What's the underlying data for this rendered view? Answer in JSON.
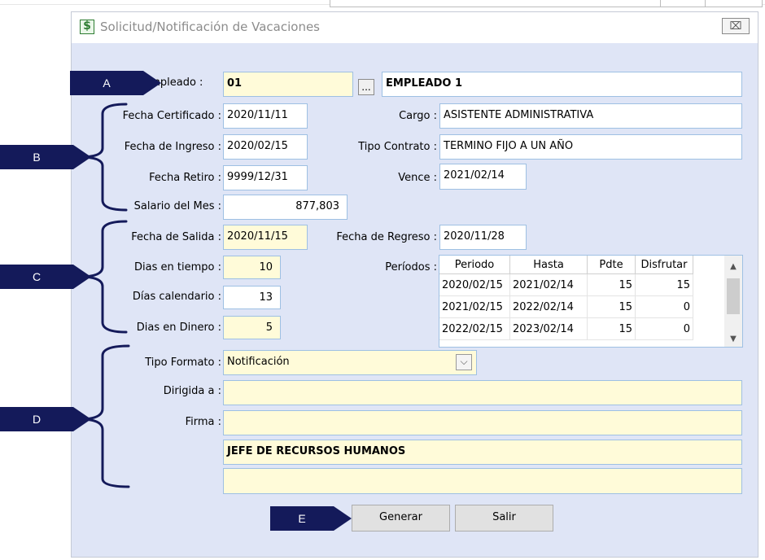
{
  "window": {
    "title": "Solicitud/Notificación de Vacaciones",
    "close_glyph": "⌧",
    "icon_glyph": "$"
  },
  "callouts": {
    "a": "A",
    "b": "B",
    "c": "C",
    "d": "D",
    "e": "E"
  },
  "employee": {
    "label": "Empleado :",
    "code": "01",
    "lookup": "...",
    "name": "EMPLEADO 1"
  },
  "fecha_certificado": {
    "label": "Fecha Certificado :",
    "value": "2020/11/11"
  },
  "fecha_ingreso": {
    "label": "Fecha de Ingreso :",
    "value": "2020/02/15"
  },
  "fecha_retiro": {
    "label": "Fecha Retiro :",
    "value": "9999/12/31"
  },
  "salario": {
    "label": "Salario del Mes :",
    "value": "877,803"
  },
  "cargo": {
    "label": "Cargo :",
    "value": "ASISTENTE ADMINISTRATIVA"
  },
  "tipo_contrato": {
    "label": "Tipo Contrato :",
    "value": "TERMINO FIJO A UN AÑO"
  },
  "vence": {
    "label": "Vence :",
    "value": "2021/02/14"
  },
  "fecha_salida": {
    "label": "Fecha de Salida :",
    "value": "2020/11/15"
  },
  "fecha_regreso": {
    "label": "Fecha de Regreso :",
    "value": "2020/11/28"
  },
  "dias_tiempo": {
    "label": "Dias en tiempo :",
    "value": "10"
  },
  "dias_calendario": {
    "label": "Días calendario :",
    "value": "13"
  },
  "dias_dinero": {
    "label": "Dias en Dinero :",
    "value": "5"
  },
  "periodos": {
    "label": "Períodos :",
    "columns": [
      "Periodo",
      "Hasta",
      "Pdte",
      "Disfrutar"
    ],
    "rows": [
      [
        "2020/02/15",
        "2021/02/14",
        "15",
        "15"
      ],
      [
        "2021/02/15",
        "2022/02/14",
        "15",
        "0"
      ],
      [
        "2022/02/15",
        "2023/02/14",
        "15",
        "0"
      ]
    ],
    "scroll_up": "▲",
    "scroll_down": "▼"
  },
  "tipo_formato": {
    "label": "Tipo Formato :",
    "value": "Notificación",
    "arrow": "⌵"
  },
  "dirigida": {
    "label": "Dirigida a :",
    "value": ""
  },
  "firma": {
    "label": "Firma :",
    "line1": "",
    "line2": "JEFE DE RECURSOS HUMANOS",
    "line3": ""
  },
  "buttons": {
    "generar": "Generar",
    "salir": "Salir"
  },
  "colors": {
    "callout": "#141a5a",
    "window_bg": "#dfe5f6",
    "yellow_field": "#fffbd9",
    "field_border": "#9ec0e3"
  }
}
